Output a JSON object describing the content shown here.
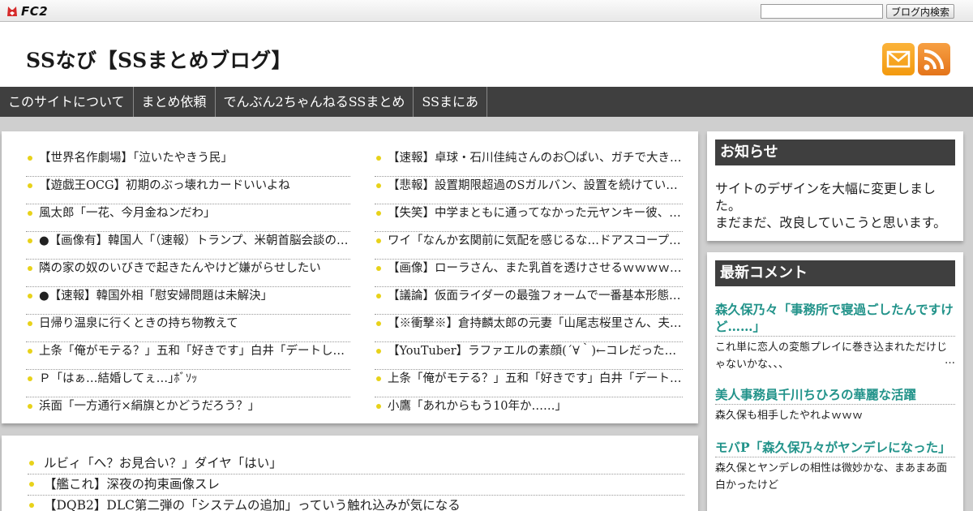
{
  "fc2": {
    "logo_text": "FC2",
    "search_placeholder": "",
    "search_button": "ブログ内検索"
  },
  "header": {
    "title": "SSなび【SSまとめブログ】",
    "icons": [
      "mail-icon",
      "rss-icon"
    ]
  },
  "nav": [
    "このサイトについて",
    "まとめ依頼",
    "でんぶん2ちゃんねるSSまとめ",
    "SSまにあ"
  ],
  "links_left": [
    "【世界名作劇場】「泣いたやきう民」",
    "【遊戯王OCG】初期のぶっ壊れカードいいよね",
    "風太郎「一花、今月金ねンだわ」",
    "●【画像有】韓国人「（速報）トランプ、米朝首脳会談の…",
    "隣の家の奴のいびきで起きたんやけど嫌がらせしたい",
    "●【速報】韓国外相「慰安婦問題は未解決」",
    "日帰り温泉に行くときの持ち物教えて",
    "上条「俺がモテる？」五和「好きです」白井「デートしま…",
    "Ｐ「はぁ…結婚してぇ…｣ﾎﾞｿｯ",
    "浜面「一方通行×絹旗とかどうだろう？」"
  ],
  "links_right": [
    "【速報】卓球・石川佳純さんのお〇ぱい、ガチで大きく…",
    "【悲報】設置期限超過のSガルバン、設置を続けている…",
    "【失笑】中学まともに通ってなかった元ヤンキー彼、メ…",
    "ワイ「なんか玄関前に気配を感じるな…ドアスコープ見…",
    "【画像】ローラさん、また乳首を透けさせるｗｗｗｗｗ…",
    "【議論】仮面ライダーの最強フォームで一番基本形態か…",
    "【※衝撃※】倉持麟太郎の元妻「山尾志桜里さん、夫と…",
    "【YouTuber】ラファエルの素顔(´∀｀)←コレだったｗｗ…",
    "上条「俺がモテる？」五和「好きです」白井「デートし…",
    "小鷹「あれからもう10年か……」"
  ],
  "list2": [
    "ルビィ「へ？お見合い？」ダイヤ「はい」",
    "【艦これ】深夜の拘束画像スレ",
    "【DQB2】DLC第二弾の「システムの追加」っていう触れ込みが気になる"
  ],
  "notice": {
    "heading": "お知らせ",
    "body": "サイトのデザインを大幅に変更しました。\nまだまだ、改良していこうと思います。"
  },
  "comments": {
    "heading": "最新コメント",
    "items": [
      {
        "title": "森久保乃々「事務所で寝過ごしたんですけど……」",
        "body": "これ単に恋人の変態プレイに巻き込まれただけじゃないかな、、、",
        "more": "…"
      },
      {
        "title": "美人事務員千川ちひろの華麗な活躍",
        "body": "森久保も相手したやれよｗｗｗ"
      },
      {
        "title": "モバP「森久保乃々がヤンデレになった」",
        "body": "森久保とヤンデレの相性は微妙かな、まあまあ面白かったけど"
      }
    ]
  }
}
